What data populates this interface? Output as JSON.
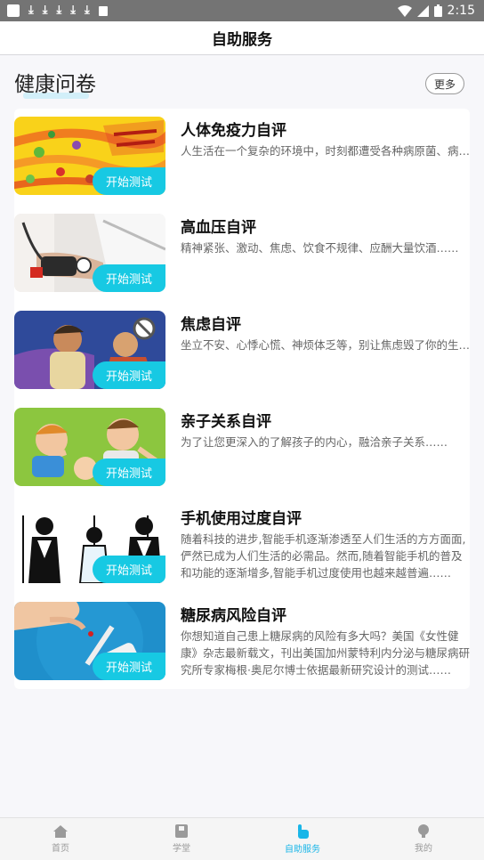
{
  "status_bar": {
    "time": "2:15"
  },
  "header": {
    "title": "自助服务"
  },
  "section": {
    "title": "健康问卷",
    "more_label": "更多"
  },
  "start_label": "开始测试",
  "cards": [
    {
      "title": "人体免疫力自评",
      "desc": "人生活在一个复杂的环境中，时刻都遭受各种病原菌、病毒、寄生虫的侵袭……"
    },
    {
      "title": "高血压自评",
      "desc": "精神紧张、激动、焦虑、饮食不规律、应酬大量饮酒……"
    },
    {
      "title": "焦虑自评",
      "desc": "坐立不安、心悸心慌、神烦体乏等，别让焦虑毁了你的生活……"
    },
    {
      "title": "亲子关系自评",
      "desc": "为了让您更深入的了解孩子的内心，融洽亲子关系……"
    },
    {
      "title": "手机使用过度自评",
      "desc": "随着科技的进步,智能手机逐渐渗透至人们生活的方方面面,俨然已成为人们生活的必需品。然而,随着智能手机的普及和功能的逐渐增多,智能手机过度使用也越来越普遍……"
    },
    {
      "title": "糖尿病风险自评",
      "desc": "你想知道自己患上糖尿病的风险有多大吗？美国《女性健康》杂志最新载文，刊出美国加州蒙特利内分泌与糖尿病研究所专家梅根·奥尼尔博士依据最新研究设计的测试……"
    }
  ],
  "tabs": [
    {
      "label": "首页",
      "icon": "home-icon"
    },
    {
      "label": "学堂",
      "icon": "book-icon"
    },
    {
      "label": "自助服务",
      "icon": "hand-pointer-icon"
    },
    {
      "label": "我的",
      "icon": "user-icon"
    }
  ],
  "colors": {
    "accent": "#17c9e3",
    "tab_active": "#19b6e8"
  }
}
